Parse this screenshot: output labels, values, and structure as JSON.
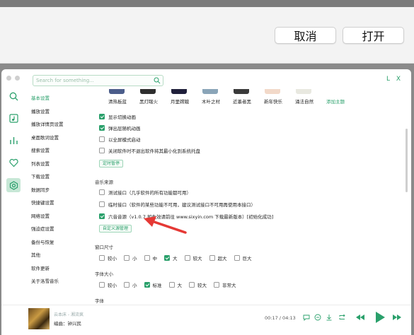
{
  "dialog": {
    "cancel": "取消",
    "open": "打开"
  },
  "search": {
    "placeholder": "Search for something..."
  },
  "window_brand": "L X",
  "sidebar_menu": [
    "基本设置",
    "播放设置",
    "播放详情页设置",
    "桌面歌词设置",
    "搜索设置",
    "列表设置",
    "下载设置",
    "数据同步",
    "快捷键设置",
    "网络设置",
    "强迫症设置",
    "备份与恢复",
    "其他",
    "软件更新",
    "关于洛雪音乐"
  ],
  "themes": [
    {
      "label": "清热板蓝",
      "color": "#4b5d8a"
    },
    {
      "label": "黑灯瞎火",
      "color": "#2e2e2e"
    },
    {
      "label": "月里嫦娥",
      "color": "#1f1f3a"
    },
    {
      "label": "木叶之村",
      "color": "#8aa5b8"
    },
    {
      "label": "近墨者黑",
      "color": "#3a3a3a"
    },
    {
      "label": "新年快乐",
      "color": "#f2d9c9"
    },
    {
      "label": "涌法自然",
      "color": "#e8e8e0"
    },
    {
      "label": "添加主题",
      "color": "#ffffff"
    }
  ],
  "basic": {
    "show_switch_anim": "显示切换动画",
    "popup_random_anim": "弹出层随机动画",
    "fullscreen_start": "以全屏模式启动",
    "close_to_tray": "关闭软件时不退出软件将其最小化到系统托盘",
    "custom_wallpaper": "定时暂停"
  },
  "music_source": {
    "title": "音乐来源",
    "test_api": "测试接口（几乎软件的所有功能都可用）",
    "temp_api": "临时接口（软件的某些功能不可用，建议测试接口不可用再使用本接口）",
    "six_source": "六音音源（v1.0.7 如失效请前往 www.sixyin.com 下载最新版本）[初始化成功]",
    "custom_btn": "自定义源管理"
  },
  "window_size": {
    "title": "窗口尺寸",
    "options": [
      "较小",
      "小",
      "中",
      "大",
      "较大",
      "超大",
      "巨大"
    ],
    "selected": "大"
  },
  "font_size": {
    "title": "字体大小",
    "options": [
      "较小",
      "小",
      "标准",
      "大",
      "较大",
      "非常大"
    ],
    "selected": "标准"
  },
  "font_title": "字体",
  "player": {
    "song": "云本床 - 湘流疯",
    "author": "编曲：钟兴民",
    "time": "00:17 / 04:13"
  },
  "colors": {
    "accent": "#2aa06b"
  },
  "icons": [
    "search-icon",
    "music-library-icon",
    "chart-icon",
    "heart-icon",
    "settings-icon",
    "comment-icon",
    "lyric-icon",
    "prev-icon",
    "play-icon",
    "next-icon"
  ]
}
